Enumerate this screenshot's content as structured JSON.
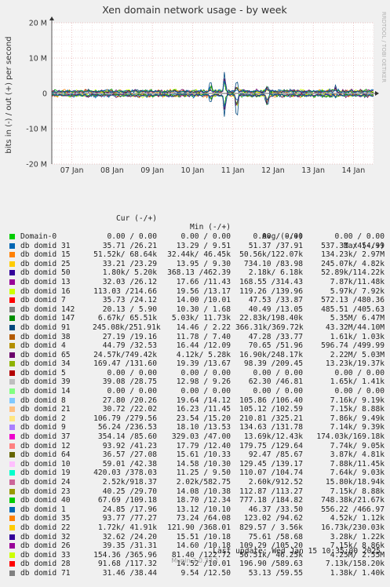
{
  "chart_data": {
    "type": "line",
    "title": "Xen domain network usage - by week",
    "ylabel": "bits in (-) / out (+) per second",
    "side_label": "RRDTOOL / TOBI OETIKER",
    "ylim": [
      -20000000,
      20000000
    ],
    "yticks": [
      {
        "v": 20000000,
        "label": "20 M"
      },
      {
        "v": 10000000,
        "label": "10 M"
      },
      {
        "v": 0,
        "label": "0"
      },
      {
        "v": -10000000,
        "label": "-10 M"
      },
      {
        "v": -20000000,
        "label": "-20 M"
      }
    ],
    "xticks": [
      "07 Jan",
      "08 Jan",
      "09 Jan",
      "10 Jan",
      "11 Jan",
      "12 Jan",
      "13 Jan",
      "14 Jan"
    ],
    "grid": true,
    "spikes": [
      {
        "day": 3.95,
        "out": 6500000,
        "in": -5000000
      },
      {
        "day": 4.3,
        "out": 11000000,
        "in": -12000000
      },
      {
        "day": 4.6,
        "out": 7000000,
        "in": -13500000
      },
      {
        "day": 5.35,
        "out": 5000000,
        "in": -8500000
      },
      {
        "day": 7.05,
        "out": 4000000,
        "in": -1500000
      }
    ]
  },
  "legend": {
    "headers": {
      "cur": "Cur (-/+)",
      "min": "Min (-/+)",
      "avg": "Avg (-/+)",
      "max": "Max (-/+)"
    },
    "rows": [
      {
        "name": "Domain-0",
        "color": "#00cc00",
        "cur": "0.00 / 0.00",
        "min": "0.00 / 0.00",
        "avg": "0.00 / 0.00",
        "max": "0.00 / 0.00"
      },
      {
        "name": "db domid 31",
        "color": "#0066b3",
        "cur": "35.71 /26.21",
        "min": "13.29 / 9.51",
        "avg": "51.37 /37.91",
        "max": "537.31 /454.99"
      },
      {
        "name": "db domid 15",
        "color": "#ff8000",
        "cur": "51.52k/ 68.64k",
        "min": "32.44k/ 46.45k",
        "avg": "50.56k/122.07k",
        "max": "134.23k/ 2.97M"
      },
      {
        "name": "db domid 25",
        "color": "#ffcc00",
        "cur": "33.21 /23.29",
        "min": "13.95 / 9.30",
        "avg": "734.10 /83.98",
        "max": "245.07k/ 4.82k"
      },
      {
        "name": "db domid 50",
        "color": "#330099",
        "cur": "1.80k/ 5.20k",
        "min": "368.13 /462.39",
        "avg": "2.18k/ 6.18k",
        "max": "52.89k/114.22k"
      },
      {
        "name": "db domid 13",
        "color": "#990099",
        "cur": "32.03 /26.12",
        "min": "17.66 /11.43",
        "avg": "168.55 /314.43",
        "max": "7.87k/11.48k"
      },
      {
        "name": "db domid 16",
        "color": "#ccff00",
        "cur": "113.03 /214.66",
        "min": "19.56 /13.17",
        "avg": "119.26 /139.96",
        "max": "5.97k/ 7.92k"
      },
      {
        "name": "db domid 7",
        "color": "#ff0000",
        "cur": "35.73 /24.12",
        "min": "14.00 /10.01",
        "avg": "47.53 /33.87",
        "max": "572.13 /480.36"
      },
      {
        "name": "db domid 142",
        "color": "#808080",
        "cur": "20.13 / 5.90",
        "min": "10.30 / 1.68",
        "avg": "40.49 /13.05",
        "max": "485.51 /405.63"
      },
      {
        "name": "db domid 147",
        "color": "#008f00",
        "cur": "6.67k/ 65.51k",
        "min": "5.03k/ 11.73k",
        "avg": "22.83k/198.40k",
        "max": "5.35M/ 6.47M"
      },
      {
        "name": "db domid 91",
        "color": "#00487d",
        "cur": "245.08k/251.91k",
        "min": "14.46 / 2.22",
        "avg": "366.31k/369.72k",
        "max": "43.32M/44.10M"
      },
      {
        "name": "db domid 38",
        "color": "#b35a00",
        "cur": "27.19 /19.16",
        "min": "11.78 / 7.40",
        "avg": "47.28 /33.77",
        "max": "1.61k/ 1.03k"
      },
      {
        "name": "db domid 4",
        "color": "#b38f00",
        "cur": "44.79 /32.53",
        "min": "16.44 /12.09",
        "avg": "70.65 /51.96",
        "max": "596.74 /499.99"
      },
      {
        "name": "db domid 65",
        "color": "#6b006b",
        "cur": "24.57k/749.42k",
        "min": "4.12k/ 5.28k",
        "avg": "16.90k/248.17k",
        "max": "2.22M/ 5.03M"
      },
      {
        "name": "db domid 34",
        "color": "#8fb300",
        "cur": "169.47 /131.60",
        "min": "19.39 /13.67",
        "avg": "98.39 /209.45",
        "max": "13.23k/19.37k"
      },
      {
        "name": "db domid 5",
        "color": "#b30000",
        "cur": "0.00 / 0.00",
        "min": "0.00 / 0.00",
        "avg": "0.00 / 0.00",
        "max": "0.00 / 0.00"
      },
      {
        "name": "db domid 39",
        "color": "#bebebe",
        "cur": "39.08 /28.75",
        "min": "12.98 / 9.26",
        "avg": "62.30 /46.81",
        "max": "1.65k/ 1.41k"
      },
      {
        "name": "db domid 14",
        "color": "#80ff80",
        "cur": "0.00 / 0.00",
        "min": "0.00 / 0.00",
        "avg": "0.00 / 0.00",
        "max": "0.00 / 0.00"
      },
      {
        "name": "db domid 8",
        "color": "#80c9ff",
        "cur": "27.80 /20.26",
        "min": "19.64 /14.12",
        "avg": "105.86 /106.40",
        "max": "7.16k/ 9.19k"
      },
      {
        "name": "db domid 21",
        "color": "#ffc080",
        "cur": "30.72 /22.02",
        "min": "16.23 /11.45",
        "avg": "105.12 /102.59",
        "max": "7.15k/ 8.88k"
      },
      {
        "name": "db domid 2",
        "color": "#ffe680",
        "cur": "106.79 /279.56",
        "min": "23.54 /15.20",
        "avg": "210.81 /325.21",
        "max": "7.86k/ 9.49k"
      },
      {
        "name": "db domid 9",
        "color": "#aa80ff",
        "cur": "56.24 /236.53",
        "min": "18.10 /13.53",
        "avg": "134.63 /131.78",
        "max": "7.14k/ 9.39k"
      },
      {
        "name": "db domid 37",
        "color": "#ee00cc",
        "cur": "354.14 /85.60",
        "min": "329.03 /47.00",
        "avg": "13.69k/12.43k",
        "max": "174.03k/169.18k"
      },
      {
        "name": "db domid 12",
        "color": "#ff8080",
        "cur": "93.92 /41.23",
        "min": "17.79 /12.40",
        "avg": "179.75 /129.64",
        "max": "7.74k/ 9.05k"
      },
      {
        "name": "db domid 64",
        "color": "#666600",
        "cur": "36.57 /27.08",
        "min": "15.61 /10.33",
        "avg": "92.47 /85.67",
        "max": "3.87k/ 4.81k"
      },
      {
        "name": "db domid 10",
        "color": "#ffbfff",
        "cur": "59.01 /42.38",
        "min": "14.58 /10.30",
        "avg": "129.45 /139.17",
        "max": "7.88k/11.45k"
      },
      {
        "name": "db domid 19",
        "color": "#00ffcc",
        "cur": "420.03 /378.03",
        "min": "11.25 / 9.50",
        "avg": "110.07 /104.74",
        "max": "7.64k/ 9.03k"
      },
      {
        "name": "db domid 24",
        "color": "#cc6699",
        "cur": "2.52k/918.37",
        "min": "2.02k/582.75",
        "avg": "2.60k/912.52",
        "max": "15.80k/18.94k"
      },
      {
        "name": "db domid 23",
        "color": "#999900",
        "cur": "40.25 /29.70",
        "min": "14.08 /10.38",
        "avg": "112.87 /113.27",
        "max": "7.15k/ 8.88k"
      },
      {
        "name": "db domid 40",
        "color": "#00cc00",
        "cur": "67.69 /109.18",
        "min": "18.70 /12.34",
        "avg": "777.18 /184.82",
        "max": "748.38k/21.67k"
      },
      {
        "name": "db domid 1",
        "color": "#0066b3",
        "cur": "24.85 /17.96",
        "min": "13.12 /10.10",
        "avg": "46.37 /33.50",
        "max": "556.22 /466.97"
      },
      {
        "name": "db domid 35",
        "color": "#ff8000",
        "cur": "93.77 /77.27",
        "min": "73.24 /64.08",
        "avg": "123.02 /94.62",
        "max": "4.52k/ 1.12k"
      },
      {
        "name": "db domid 22",
        "color": "#ffcc00",
        "cur": "1.72k/ 41.91k",
        "min": "121.90 /368.01",
        "avg": "829.57 / 3.56k",
        "max": "16.73k/230.03k"
      },
      {
        "name": "db domid 32",
        "color": "#330099",
        "cur": "32.62 /24.20",
        "min": "15.51 /10.18",
        "avg": "75.61 /58.68",
        "max": "3.28k/ 1.22k"
      },
      {
        "name": "db domid 26",
        "color": "#990099",
        "cur": "39.35 /31.31",
        "min": "14.60 /10.18",
        "avg": "109.29 /105.20",
        "max": "7.15k/ 8.86k"
      },
      {
        "name": "db domid 33",
        "color": "#ccff00",
        "cur": "154.36 /365.96",
        "min": "81.40 /122.72",
        "avg": "56.51k/ 46.25k",
        "max": "4.25M/ 2.55M"
      },
      {
        "name": "db domid 28",
        "color": "#ff0000",
        "cur": "91.68 /117.32",
        "min": "14.52 /10.01",
        "avg": "196.90 /589.63",
        "max": "7.13k/158.20k"
      },
      {
        "name": "db domid 71",
        "color": "#808080",
        "cur": "31.46 /38.44",
        "min": "9.54 /12.50",
        "avg": "53.13 /59.55",
        "max": "1.38k/ 1.40k"
      }
    ]
  },
  "footer": {
    "last_update": "Last update:  Wed Jan 15 10:35:00 2025",
    "munin": "Munin 2.0.33-1"
  }
}
